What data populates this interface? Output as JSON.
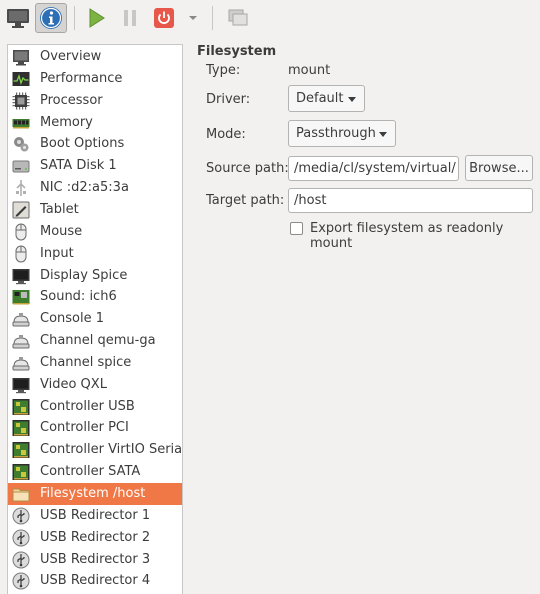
{
  "toolbar": {
    "buttons": [
      {
        "icon": "monitor-icon",
        "label": "Show the graphical console"
      },
      {
        "icon": "info-icon",
        "label": "Show virtual hardware details"
      },
      {
        "icon": "play-icon",
        "label": "Run"
      },
      {
        "icon": "pause-icon",
        "label": "Pause"
      },
      {
        "icon": "power-icon",
        "label": "Shut down"
      },
      {
        "icon": "dropdown-arrow-icon",
        "label": ""
      },
      {
        "icon": "snapshots-icon",
        "label": ""
      }
    ]
  },
  "sidebar": {
    "items": [
      {
        "label": "Overview",
        "icon": "overview-icon"
      },
      {
        "label": "Performance",
        "icon": "performance-icon"
      },
      {
        "label": "Processor",
        "icon": "processor-icon"
      },
      {
        "label": "Memory",
        "icon": "memory-icon"
      },
      {
        "label": "Boot Options",
        "icon": "boot-options-icon"
      },
      {
        "label": "SATA Disk 1",
        "icon": "disk-icon"
      },
      {
        "label": "NIC :d2:a5:3a",
        "icon": "nic-icon"
      },
      {
        "label": "Tablet",
        "icon": "tablet-icon"
      },
      {
        "label": "Mouse",
        "icon": "mouse-icon"
      },
      {
        "label": "Input",
        "icon": "input-icon"
      },
      {
        "label": "Display Spice",
        "icon": "display-icon"
      },
      {
        "label": "Sound: ich6",
        "icon": "sound-icon"
      },
      {
        "label": "Console 1",
        "icon": "console-icon"
      },
      {
        "label": "Channel qemu-ga",
        "icon": "channel-icon"
      },
      {
        "label": "Channel spice",
        "icon": "channel-icon"
      },
      {
        "label": "Video QXL",
        "icon": "video-icon"
      },
      {
        "label": "Controller USB",
        "icon": "controller-icon"
      },
      {
        "label": "Controller PCI",
        "icon": "controller-icon"
      },
      {
        "label": "Controller VirtIO Serial",
        "icon": "controller-icon"
      },
      {
        "label": "Controller SATA",
        "icon": "controller-icon"
      },
      {
        "label": "Filesystem /host",
        "icon": "folder-icon"
      },
      {
        "label": "USB Redirector 1",
        "icon": "usb-icon"
      },
      {
        "label": "USB Redirector 2",
        "icon": "usb-icon"
      },
      {
        "label": "USB Redirector 3",
        "icon": "usb-icon"
      },
      {
        "label": "USB Redirector 4",
        "icon": "usb-icon"
      }
    ],
    "selected_index": 20
  },
  "details": {
    "section_title": "Filesystem",
    "type_label": "Type:",
    "type_value": "mount",
    "driver_label": "Driver:",
    "driver_value": "Default",
    "mode_label": "Mode:",
    "mode_value": "Passthrough",
    "source_label": "Source path:",
    "source_value": "/media/cl/system/virtual/",
    "browse_label": "Browse...",
    "target_label": "Target path:",
    "target_value": "/host",
    "readonly_label": "Export filesystem as readonly mount",
    "readonly_checked": false
  },
  "colors": {
    "selection": "#f07746",
    "play_green": "#7cb342",
    "power_red": "#e8584a",
    "info_blue": "#2d6fb5"
  }
}
